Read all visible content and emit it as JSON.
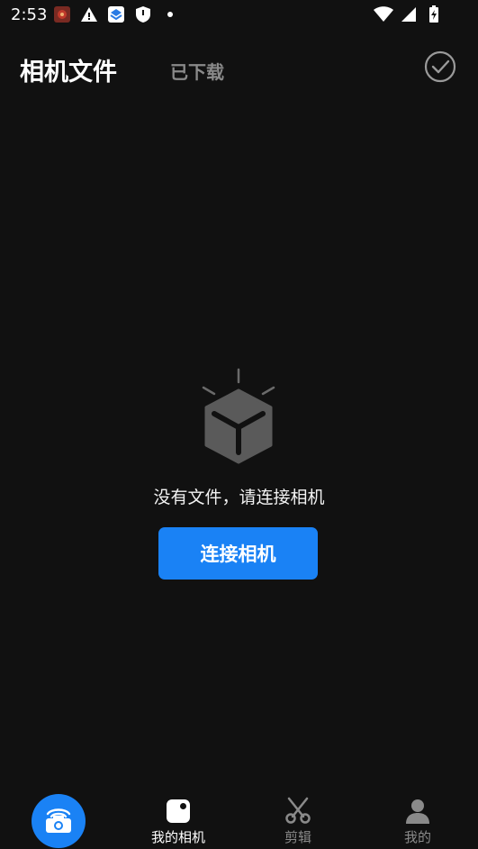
{
  "status_bar": {
    "time": "2:53",
    "icons": [
      "app-notification-icon",
      "warning-icon",
      "layers-app-icon",
      "shield-icon",
      "dot-icon",
      "wifi-icon",
      "signal-icon",
      "battery-charging-icon"
    ]
  },
  "header": {
    "tabs": [
      {
        "label": "相机文件"
      },
      {
        "label": "已下载"
      }
    ],
    "select_icon": "check-circle-icon"
  },
  "empty_state": {
    "icon": "empty-box-icon",
    "message": "没有文件，请连接相机",
    "button_label": "连接相机"
  },
  "bottom_nav": {
    "fab_icon": "camera-connect-icon",
    "items": [
      {
        "label": "我的相机",
        "icon": "my-camera-icon"
      },
      {
        "label": "剪辑",
        "icon": "scissors-icon"
      },
      {
        "label": "我的",
        "icon": "person-icon"
      }
    ]
  },
  "colors": {
    "background": "#111111",
    "accent": "#1a82f5",
    "text": "#ffffff",
    "text_dim": "#8a8a8a"
  }
}
